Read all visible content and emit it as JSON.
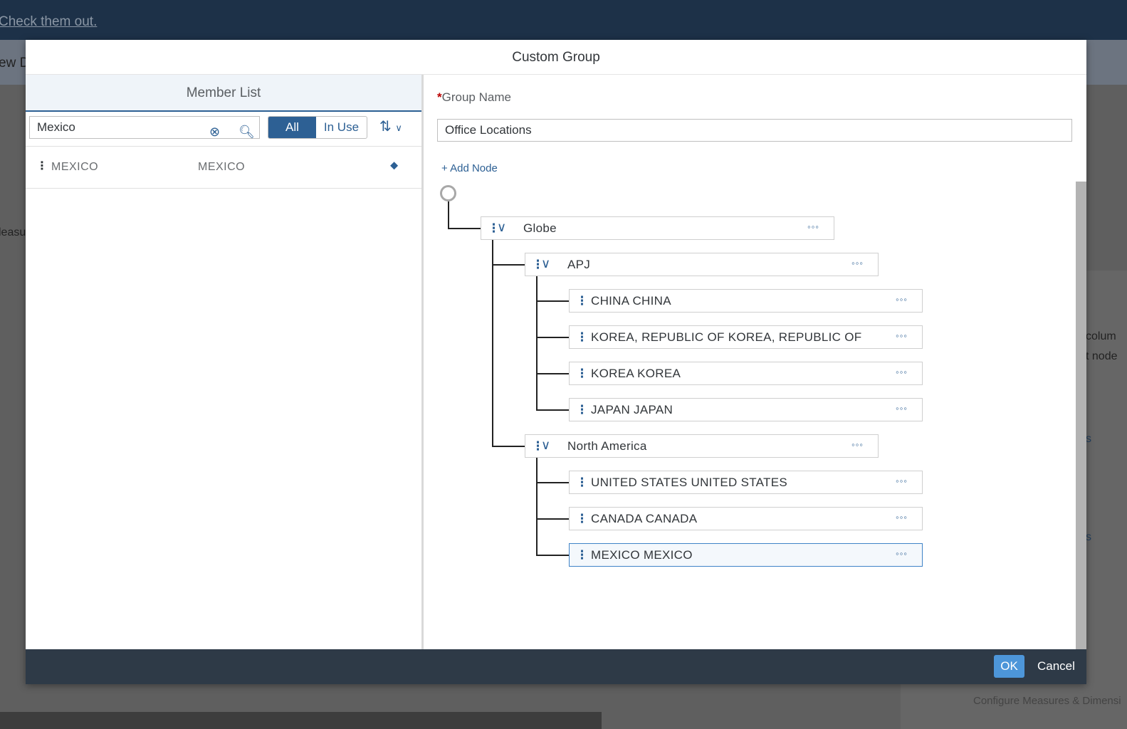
{
  "background": {
    "banner_link": "Check them out.",
    "fragments": [
      "ew D",
      "leasu",
      "colum",
      "t node",
      "s",
      "s",
      "Configure Measures & Dimensi"
    ]
  },
  "dialog": {
    "title": "Custom Group",
    "member_list": {
      "title": "Member List",
      "search_value": "Mexico",
      "filter": {
        "options": [
          "All",
          "In Use"
        ],
        "selected": "All"
      },
      "rows": [
        {
          "id": "MEXICO",
          "description": "MEXICO"
        }
      ]
    },
    "group": {
      "name_label": "Group Name",
      "required_marker": "*",
      "name_value": "Office Locations",
      "add_node": "+ Add Node",
      "tree": [
        {
          "label": "Globe",
          "level": 1,
          "expandable": true
        },
        {
          "label": "APJ",
          "level": 2,
          "expandable": true
        },
        {
          "label": "CHINA  CHINA",
          "level": 3
        },
        {
          "label": "KOREA, REPUBLIC OF  KOREA, REPUBLIC OF",
          "level": 3
        },
        {
          "label": "KOREA  KOREA",
          "level": 3
        },
        {
          "label": "JAPAN  JAPAN",
          "level": 3
        },
        {
          "label": "North America",
          "level": 2,
          "expandable": true
        },
        {
          "label": "UNITED STATES  UNITED STATES",
          "level": 3
        },
        {
          "label": "CANADA  CANADA",
          "level": 3
        },
        {
          "label": "MEXICO  MEXICO",
          "level": 3,
          "selected": true
        }
      ]
    },
    "footer": {
      "ok": "OK",
      "cancel": "Cancel"
    }
  },
  "colors": {
    "accent": "#2d6094",
    "ok": "#4d96d9",
    "header": "#1d3148",
    "footer": "#2e3a47"
  }
}
